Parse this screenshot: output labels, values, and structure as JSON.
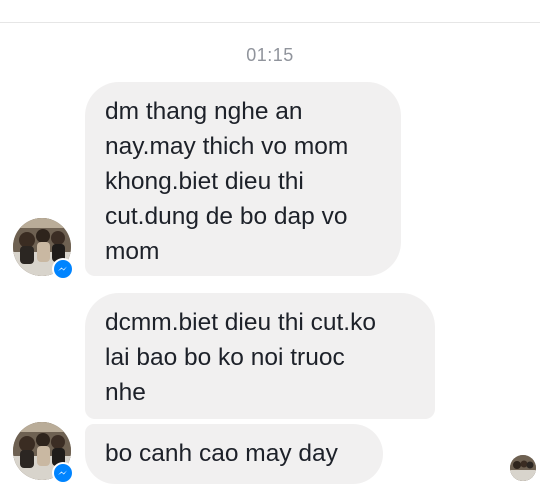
{
  "chat": {
    "timestamp": "01:15",
    "messages": [
      {
        "text": "dm thang nghe an\nnay.may thich vo mom\nkhong.biet dieu thi\ncut.dung de bo dap vo\nmom"
      },
      {
        "text": "dcmm.biet dieu thi cut.ko\nlai bao bo ko noi truoc\nnhe"
      },
      {
        "text": "bo canh cao may day"
      }
    ],
    "badge_icon": "messenger-icon",
    "colors": {
      "bubble": "#f1f0f0",
      "text": "#1d2129",
      "timestamp": "#90949c",
      "messenger_blue": "#0084ff"
    }
  }
}
